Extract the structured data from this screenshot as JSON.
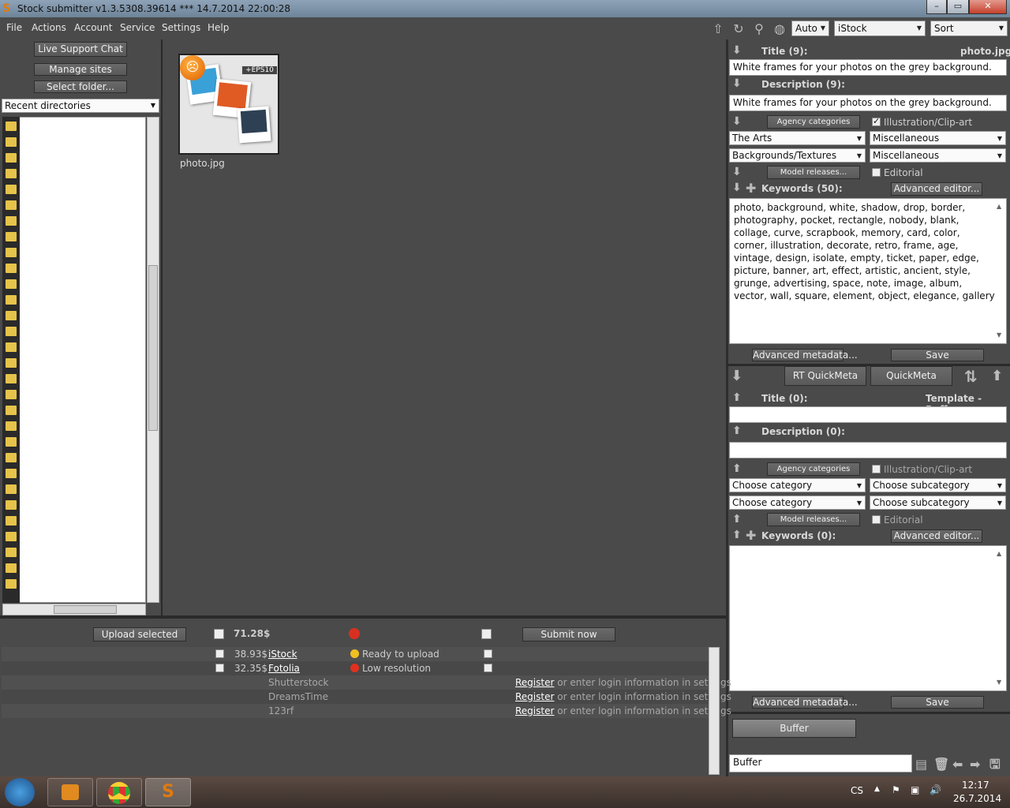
{
  "window": {
    "title": "Stock submitter v1.3.5308.39614 ***  14.7.2014 22:00:28"
  },
  "menu": [
    "File",
    "Actions",
    "Account",
    "Service",
    "Settings",
    "Help"
  ],
  "toolbar": {
    "mode": "Auto",
    "agency": "iStock",
    "sort": "Sort"
  },
  "left": {
    "live_chat": "Live Support Chat",
    "manage_sites": "Manage sites",
    "select_folder": "Select folder...",
    "recent": "Recent directories"
  },
  "thumbnail": {
    "badge": "+EPS10",
    "filename": "photo.jpg"
  },
  "meta": {
    "title_label": "Title (9):",
    "filename": "photo.jpg",
    "title": "White frames for your photos on the grey background.",
    "desc_label": "Description (9):",
    "description": "White frames for your photos on the grey background.",
    "agency_categories": "Agency categories",
    "illustration": "Illustration/Clip-art",
    "cat1": "The Arts",
    "sub1": "Miscellaneous",
    "cat2": "Backgrounds/Textures",
    "sub2": "Miscellaneous",
    "model_releases": "Model releases...",
    "editorial": "Editorial",
    "keywords_label": "Keywords (50):",
    "advanced_editor": "Advanced editor...",
    "keywords": "photo, background, white, shadow, drop, border, photography, pocket, rectangle, nobody, blank, collage, curve, scrapbook, memory, card, color, corner, illustration, decorate, retro, frame, age, vintage, design, isolate, empty, ticket, paper, edge, picture, banner, art, effect, artistic, ancient, style, grunge, advertising, space, note, image, album, vector, wall, square, element, object, elegance, gallery",
    "advanced_metadata": "Advanced metadata...",
    "save": "Save"
  },
  "quick": {
    "rt_quickmeta": "RT QuickMeta",
    "quickmeta": "QuickMeta"
  },
  "template": {
    "title_label": "Title (0):",
    "name": "Template - Buffer",
    "desc_label": "Description (0):",
    "agency_categories": "Agency categories",
    "illustration": "Illustration/Clip-art",
    "cat1": "Choose category",
    "sub1": "Choose subcategory",
    "cat2": "Choose category",
    "sub2": "Choose subcategory",
    "model_releases": "Model releases...",
    "editorial": "Editorial",
    "keywords_label": "Keywords (0):",
    "advanced_editor": "Advanced editor...",
    "advanced_metadata": "Advanced metadata...",
    "save": "Save"
  },
  "buffer": {
    "button": "Buffer",
    "name": "Buffer"
  },
  "upload": {
    "upload_selected": "Upload selected",
    "total": "71.28$",
    "submit_now": "Submit now",
    "sites": [
      {
        "amount": "38.93$",
        "name": "iStock",
        "status": "Ready to upload",
        "status_color": "#f0c020"
      },
      {
        "amount": "32.35$",
        "name": "Fotolia",
        "status": "Low resolution",
        "status_color": "#e03020"
      }
    ],
    "unregistered": [
      {
        "name": "Shutterstock",
        "register": "Register",
        "rest": "or enter login information in settings"
      },
      {
        "name": "DreamsTime",
        "register": "Register",
        "rest": "or enter login information in settings"
      },
      {
        "name": "123rf",
        "register": "Register",
        "rest": "or enter login information in settings"
      }
    ]
  },
  "taskbar": {
    "lang": "CS",
    "time": "12:17",
    "date": "26.7.2014"
  }
}
